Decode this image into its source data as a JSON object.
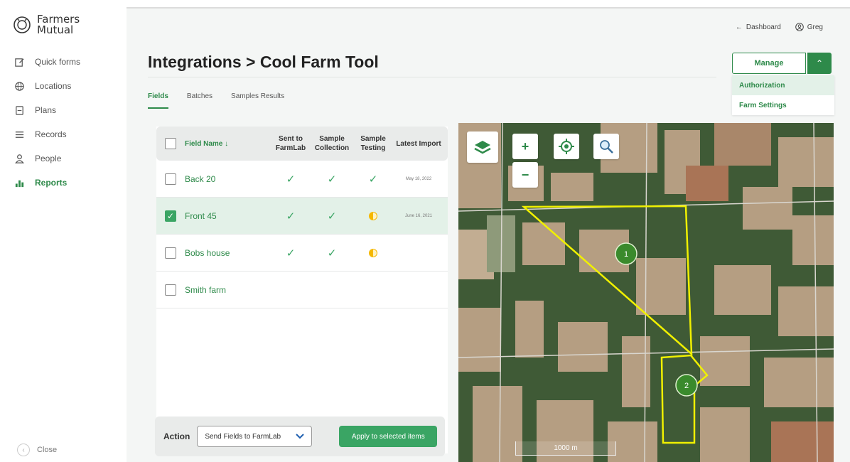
{
  "brand": {
    "line1": "Farmers",
    "line2": "Mutual"
  },
  "sidebar": {
    "items": [
      {
        "label": "Quick forms",
        "icon": "edit-icon"
      },
      {
        "label": "Locations",
        "icon": "globe-icon"
      },
      {
        "label": "Plans",
        "icon": "clipboard-icon"
      },
      {
        "label": "Records",
        "icon": "list-icon"
      },
      {
        "label": "People",
        "icon": "person-icon"
      },
      {
        "label": "Reports",
        "icon": "bar-chart-icon"
      }
    ],
    "close_label": "Close"
  },
  "topbar": {
    "dashboard": "Dashboard",
    "user": "Greg"
  },
  "page": {
    "title": "Integrations > Cool Farm Tool"
  },
  "manage": {
    "label": "Manage",
    "menu": [
      "Authorization",
      "Farm Settings"
    ]
  },
  "tabs": [
    "Fields",
    "Batches",
    "Samples Results"
  ],
  "table": {
    "headers": {
      "name": "Field Name ↓",
      "sent": "Sent to FarmLab",
      "collection": "Sample Collection",
      "testing": "Sample Testing",
      "import": "Latest Import"
    },
    "rows": [
      {
        "name": "Back 20",
        "import": "May 18, 2022"
      },
      {
        "name": "Front 45",
        "import": "June 16, 2021"
      },
      {
        "name": "Bobs house",
        "import": ""
      },
      {
        "name": "Smith farm",
        "import": ""
      }
    ]
  },
  "action": {
    "label": "Action",
    "select_value": "Send Fields to FarmLab",
    "apply_label": "Apply to selected items"
  },
  "map": {
    "markers": [
      "1",
      "2"
    ],
    "scale_label": "1000 m",
    "zoom_in": "+",
    "zoom_out": "−"
  },
  "colors": {
    "accent": "#2e8a4a",
    "check": "#3aa564",
    "partial": "#f5b800",
    "boundary": "#f0f000"
  }
}
